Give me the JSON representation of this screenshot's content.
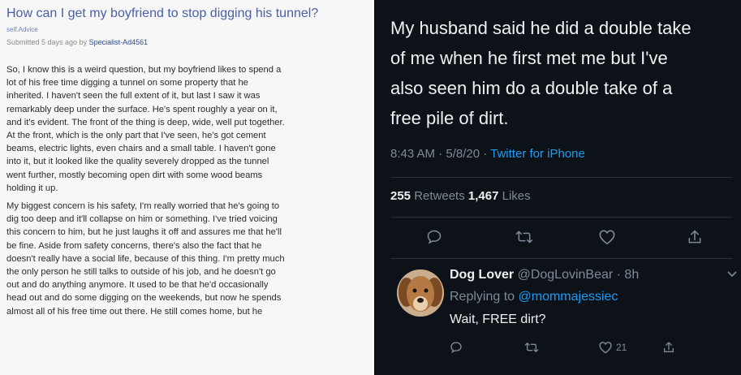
{
  "reddit": {
    "title": "How can I get my boyfriend to stop digging his tunnel?",
    "subreddit": "self.Advice",
    "submitted_prefix": "Submitted 5 days ago by ",
    "author": "Specialist-Ad4561",
    "paragraph1": [
      "So, I know this is a weird question, but my boyfriend likes to spend a",
      "lot of his free time digging a tunnel on some property that he",
      "inherited. I haven't seen the full extent of it, but last I saw it was",
      "remarkably deep under the surface. He's spent roughly a year on it,",
      "and it's evident. The front of the thing is deep, wide, well put together.",
      "At the front, which is the only part that I've seen, he's got cement",
      "beams, electric lights, even chairs and a small table. I haven't gone",
      "into it, but it looked like the quality severely dropped as the tunnel",
      "went further, mostly becoming open dirt with some wood beams",
      "holding it up."
    ],
    "paragraph2": [
      "My biggest concern is his safety, I'm really worried that he's going to",
      "dig too deep and it'll collapse on him or something. I've tried voicing",
      "this concern to him, but he just laughs it off and assures me that he'll",
      "be fine. Aside from safety concerns, there's also the fact that he",
      "doesn't really have a social life, because of this thing. I'm pretty much",
      "the only person he still talks to outside of his job, and he doesn't go",
      "out and do anything anymore. It used to be that he'd occasionally",
      "head out and do some digging on the weekends, but now he spends",
      "almost all of his free time out there. He still comes home, but he"
    ]
  },
  "tweet": {
    "lines": [
      "My husband said he did a double take",
      "of me when he first met me but I've",
      "also seen him do a double take of a",
      "free pile of dirt."
    ],
    "time": "8:43 AM · 5/8/20 · ",
    "source": "Twitter for iPhone",
    "retweets_count": "255",
    "retweets_label": " Retweets  ",
    "likes_count": "1,467",
    "likes_label": " Likes"
  },
  "reply": {
    "name": "Dog Lover",
    "handle": " @DogLovinBear · 8h",
    "replying_prefix": "Replying to ",
    "replying_to": "@mommajessiec",
    "text": "Wait, FREE dirt?",
    "likes": "21"
  },
  "icons": [
    "reply-icon",
    "retweet-icon",
    "like-icon",
    "share-icon",
    "chevron-down-icon"
  ],
  "colors": {
    "twitter_bg": "#0d1219",
    "link_blue": "#1d9bf0",
    "reddit_title": "#4a5fa5"
  }
}
